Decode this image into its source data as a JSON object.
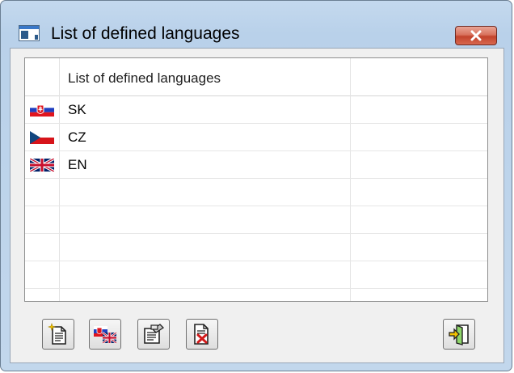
{
  "window": {
    "title": "List of defined languages"
  },
  "grid": {
    "columns": [
      "",
      "List of defined languages",
      ""
    ],
    "rows": [
      {
        "code": "SK",
        "flag": "slovak-flag-icon"
      },
      {
        "code": "CZ",
        "flag": "czech-flag-icon"
      },
      {
        "code": "EN",
        "flag": "uk-flag-icon"
      }
    ],
    "empty_rows": 4
  },
  "toolbar": {
    "buttons": [
      {
        "icon": "new-document-icon"
      },
      {
        "icon": "language-flags-icon"
      },
      {
        "icon": "edit-properties-icon"
      },
      {
        "icon": "delete-document-icon"
      },
      {
        "icon": "exit-door-icon"
      }
    ]
  },
  "colors": {
    "title_bar": "#b9d1ea",
    "close_button": "#c2432c",
    "client_background": "#f0f0f0"
  }
}
